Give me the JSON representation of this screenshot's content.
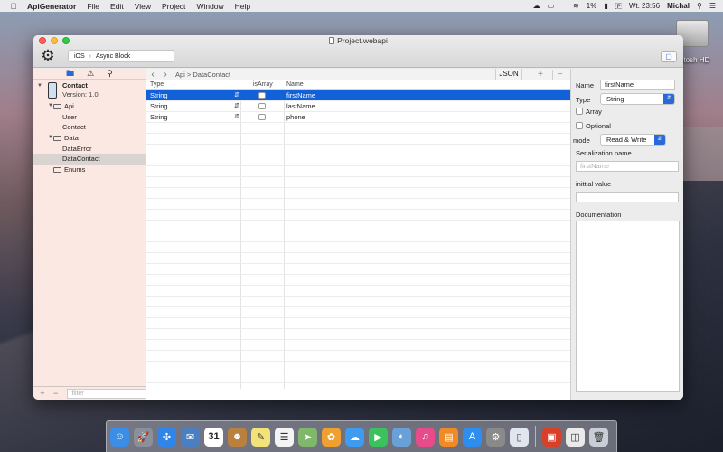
{
  "menubar": {
    "app_name": "ApiGenerator",
    "items": [
      "File",
      "Edit",
      "View",
      "Project",
      "Window",
      "Help"
    ],
    "battery": "1%",
    "clock": "Wt. 23:56",
    "user": "Michal"
  },
  "desktop": {
    "drive_label": "ntosh HD"
  },
  "window": {
    "title": "Project.webapi",
    "path_segments": [
      "iOS",
      "Async Block"
    ]
  },
  "sidebar": {
    "tree": [
      {
        "label": "Contact",
        "level": 0,
        "kind": "project",
        "expanded": true
      },
      {
        "label": "Version: 1.0",
        "level": 0,
        "kind": "subtitle"
      },
      {
        "label": "Api",
        "level": 1,
        "kind": "folder",
        "expanded": true
      },
      {
        "label": "User",
        "level": 2,
        "kind": "item"
      },
      {
        "label": "Contact",
        "level": 2,
        "kind": "item"
      },
      {
        "label": "Data",
        "level": 1,
        "kind": "folder",
        "expanded": true
      },
      {
        "label": "DataError",
        "level": 2,
        "kind": "item"
      },
      {
        "label": "DataContact",
        "level": 2,
        "kind": "item",
        "selected": true
      },
      {
        "label": "Enums",
        "level": 1,
        "kind": "folder"
      }
    ],
    "filter_placeholder": "filter"
  },
  "editor": {
    "breadcrumb": "Api > DataContact",
    "json_button": "JSON",
    "columns": {
      "type": "Type",
      "is_array": "isArray",
      "name": "Name"
    },
    "rows": [
      {
        "type": "String",
        "is_array": false,
        "name": "firstName",
        "selected": true
      },
      {
        "type": "String",
        "is_array": false,
        "name": "lastName",
        "selected": false
      },
      {
        "type": "String",
        "is_array": false,
        "name": "phone",
        "selected": false
      }
    ]
  },
  "inspector": {
    "name_label": "Name",
    "name_value": "firstName",
    "type_label": "Type",
    "type_value": "String",
    "array_label": "Array",
    "optional_label": "Optional",
    "mode_label": "mode",
    "mode_value": "Read & Write",
    "serialization_label": "Serialization name",
    "serialization_placeholder": "firstName",
    "initial_value_label": "inittial value",
    "documentation_label": "Documentation"
  },
  "dock": {
    "apps": [
      "Finder",
      "Launchpad",
      "Safari",
      "Mail",
      "Calendar",
      "Contacts",
      "Notes",
      "Reminders",
      "Maps",
      "Photos",
      "Messages",
      "FaceTime",
      "iPhoto",
      "iTunes",
      "iBooks",
      "App Store",
      "System Preferences",
      "ApiGenerator",
      "Flashcards",
      "Preview",
      "Trash"
    ],
    "colors": [
      "#3a8ee6",
      "#8a8f99",
      "#2f86e8",
      "#4a7fc2",
      "#ffffff",
      "#b9803e",
      "#f3e27a",
      "#f4f4f4",
      "#7fb86a",
      "#f0a030",
      "#3e9bef",
      "#3bc25c",
      "#6aa0d8",
      "#e84b8a",
      "#f08a24",
      "#2d8ef0",
      "#8a8a8a",
      "#dfe6ee",
      "#d8402a",
      "#eaeaea",
      "#c9ced6"
    ],
    "calendar_day": "31"
  }
}
